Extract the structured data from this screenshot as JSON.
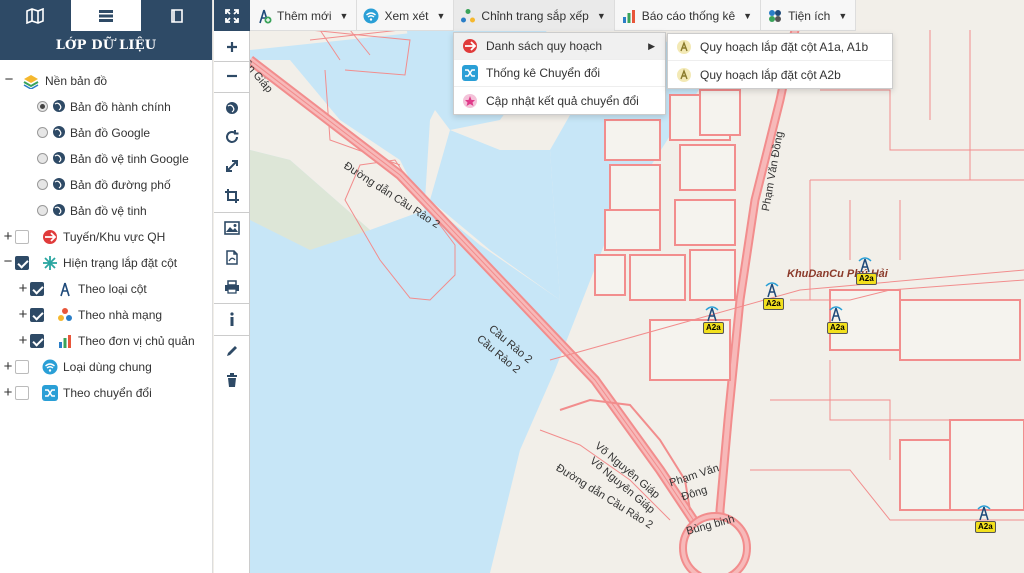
{
  "left_panel": {
    "tabs": [
      {
        "icon": "map-icon"
      },
      {
        "icon": "layers-list-icon"
      },
      {
        "icon": "book-icon"
      }
    ],
    "title": "LỚP DỮ LIỆU",
    "tree": {
      "base_maps": {
        "label": "Nền bản đồ",
        "items": [
          {
            "label": "Bản đồ hành chính",
            "selected": true
          },
          {
            "label": "Bản đồ Google",
            "selected": false
          },
          {
            "label": "Bản đồ vệ tinh Google",
            "selected": false
          },
          {
            "label": "Bản đồ đường phố",
            "selected": false
          },
          {
            "label": "Bản đồ vệ tinh",
            "selected": false
          }
        ]
      },
      "planning_routes": {
        "label": "Tuyến/Khu vực QH",
        "checked": false
      },
      "pole_status": {
        "label": "Hiện trạng lắp đặt cột",
        "checked": true,
        "children": [
          {
            "label": "Theo loại cột",
            "checked": true
          },
          {
            "label": "Theo nhà mạng",
            "checked": true
          },
          {
            "label": "Theo đơn vị chủ quản",
            "checked": true
          }
        ]
      },
      "shared_type": {
        "label": "Loại dùng chung",
        "checked": false
      },
      "conversion": {
        "label": "Theo chuyển đổi",
        "checked": false
      }
    }
  },
  "toolbar": {
    "items": [
      {
        "label": "Thêm mới"
      },
      {
        "label": "Xem xét"
      },
      {
        "label": "Chỉnh trang sắp xếp"
      },
      {
        "label": "Báo cáo thống kê"
      },
      {
        "label": "Tiện ích"
      }
    ]
  },
  "dropdown": {
    "items": [
      {
        "label": "Danh sách quy hoạch"
      },
      {
        "label": "Thống kê Chuyển đổi"
      },
      {
        "label": "Cập nhật kết quả chuyển đổi"
      }
    ],
    "submenu": [
      {
        "label": "Quy hoạch lắp đặt cột A1a, A1b"
      },
      {
        "label": "Quy hoạch lắp đặt cột A2b"
      }
    ]
  },
  "map": {
    "labels": {
      "dan_cau_rao_top": "Đường dẫn Cầu Rào 2",
      "cau_rao_a": "Cầu Rào 2",
      "cau_rao_b": "Cầu Rào 2",
      "vo_nguyen_giap_a": "Võ Nguyên Giáp",
      "vo_nguyen_giap_b": "Võ Nguyên Giáp",
      "dan_cau_rao_bottom": "Đường dẫn Cầu Rào 2",
      "pham_van_dong_v": "Phạm Văn Đồng",
      "pham_van_dong_small": "Phạm Văn",
      "dong": "Đông",
      "bung_binh": "Bùng binh",
      "khu_dan_cu": "KhuDanCu Phú Hải",
      "giap_topleft": "ên Giáp"
    },
    "poi_label": "A2a",
    "colors": {
      "water": "#c7e6f7",
      "land": "#f2efe9",
      "road": "#f28d8d"
    }
  }
}
